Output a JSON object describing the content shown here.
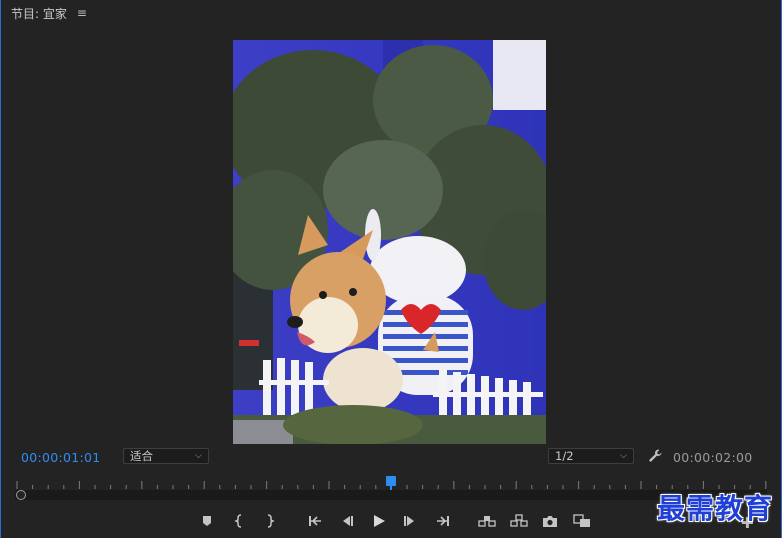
{
  "panel": {
    "title": "节目: 宜家",
    "menu_icon": "hamburger-icon"
  },
  "viewer": {
    "content": "preview-frame"
  },
  "timecode": {
    "current": "00:00:01:01",
    "duration": "00:00:02:00"
  },
  "fit_select": {
    "value": "适合"
  },
  "resolution_select": {
    "value": "1/2"
  },
  "timeline": {
    "playhead_fraction": 0.5
  },
  "transport": {
    "buttons": [
      "marker-icon",
      "mark-in-icon",
      "mark-out-icon",
      "go-to-in-icon",
      "step-back-icon",
      "play-icon",
      "step-forward-icon",
      "go-to-out-icon",
      "lift-icon",
      "extract-icon",
      "camera-icon",
      "compare-icon"
    ]
  },
  "colors": {
    "accent": "#2f8cf0",
    "panel_bg": "#232323",
    "border": "#2d6bd6"
  },
  "watermark": "最需教育"
}
